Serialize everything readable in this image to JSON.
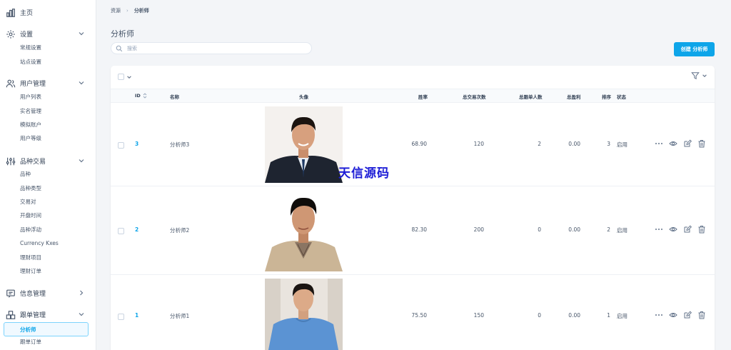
{
  "sidebar": {
    "home": "主页",
    "settings": {
      "label": "设置",
      "items": [
        "常规设置",
        "站点设置"
      ]
    },
    "users": {
      "label": "用户管理",
      "items": [
        "用户列表",
        "实名管理",
        "模拟账户",
        "用户等级"
      ]
    },
    "trading": {
      "label": "品种交易",
      "items": [
        "品种",
        "品种类型",
        "交易对",
        "开盘时间",
        "品种浮动",
        "Currency Kxes",
        "理财项目",
        "理财订单"
      ]
    },
    "messages": {
      "label": "信息管理"
    },
    "copy": {
      "label": "跟单管理",
      "items": [
        "分析师",
        "跟单订单"
      ]
    }
  },
  "breadcrumb": [
    "资源",
    "分析师"
  ],
  "page_title": "分析师",
  "search": {
    "placeholder": "搜索"
  },
  "create_button": "创建 分析师",
  "table": {
    "headers": {
      "id": "ID",
      "name": "名称",
      "avatar": "头像",
      "win_rate": "胜率",
      "total_trades": "总交易次数",
      "total_followers": "总跟单人数",
      "total_profit": "总盈利",
      "sort": "排序",
      "status": "状态"
    },
    "rows": [
      {
        "id": "3",
        "name": "分析师3",
        "win_rate": "68.90",
        "total_trades": "120",
        "total_followers": "2",
        "total_profit": "0.00",
        "sort": "3",
        "status": "启用"
      },
      {
        "id": "2",
        "name": "分析师2",
        "win_rate": "82.30",
        "total_trades": "200",
        "total_followers": "0",
        "total_profit": "0.00",
        "sort": "2",
        "status": "启用"
      },
      {
        "id": "1",
        "name": "分析师1",
        "win_rate": "75.50",
        "total_trades": "150",
        "total_followers": "0",
        "total_profit": "0.00",
        "sort": "1",
        "status": "启用"
      }
    ]
  },
  "watermark": "天信源码",
  "colors": {
    "accent": "#0ea5e9",
    "watermark": "#1d1dd6"
  }
}
